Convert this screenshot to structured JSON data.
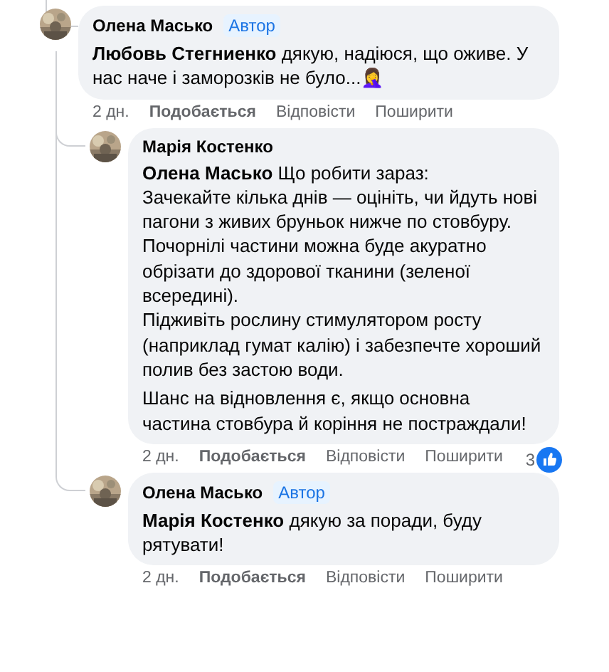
{
  "comments": [
    {
      "author": "Олена Масько",
      "badge": "Автор",
      "paragraphs": [
        [
          "**Любовь Стегниенко** дякую, надіюся, що оживе. У нас наче і заморозків не було...🤦‍♀️"
        ]
      ],
      "time": "2 дн.",
      "actions": [
        "Подобається",
        "Відповісти",
        "Поширити"
      ],
      "replies": [
        {
          "author": "Марія Костенко",
          "paragraphs": [
            [
              "**Олена Масько** Що робити зараз:",
              "Зачекайте кілька днів — оцініть, чи йдуть нові пагони з живих бруньок нижче по стовбуру.",
              "Почорнілі частини можна буде акуратно обрізати до здорової тканини (зеленої всередині).",
              "Підживіть рослину стимулятором росту (наприклад гумат калію) і забезпечте хороший полив без застою води."
            ],
            [
              "Шанс на відновлення є, якщо основна частина стовбура й коріння не постраждали!"
            ]
          ],
          "time": "2 дн.",
          "actions": [
            "Подобається",
            "Відповісти",
            "Поширити"
          ],
          "reaction_count": "3"
        },
        {
          "author": "Олена Масько",
          "badge": "Автор",
          "paragraphs": [
            [
              "**Марія Костенко** дякую за поради, буду рятувати!"
            ]
          ],
          "time": "2 дн.",
          "actions": [
            "Подобається",
            "Відповісти",
            "Поширити"
          ]
        }
      ]
    }
  ]
}
